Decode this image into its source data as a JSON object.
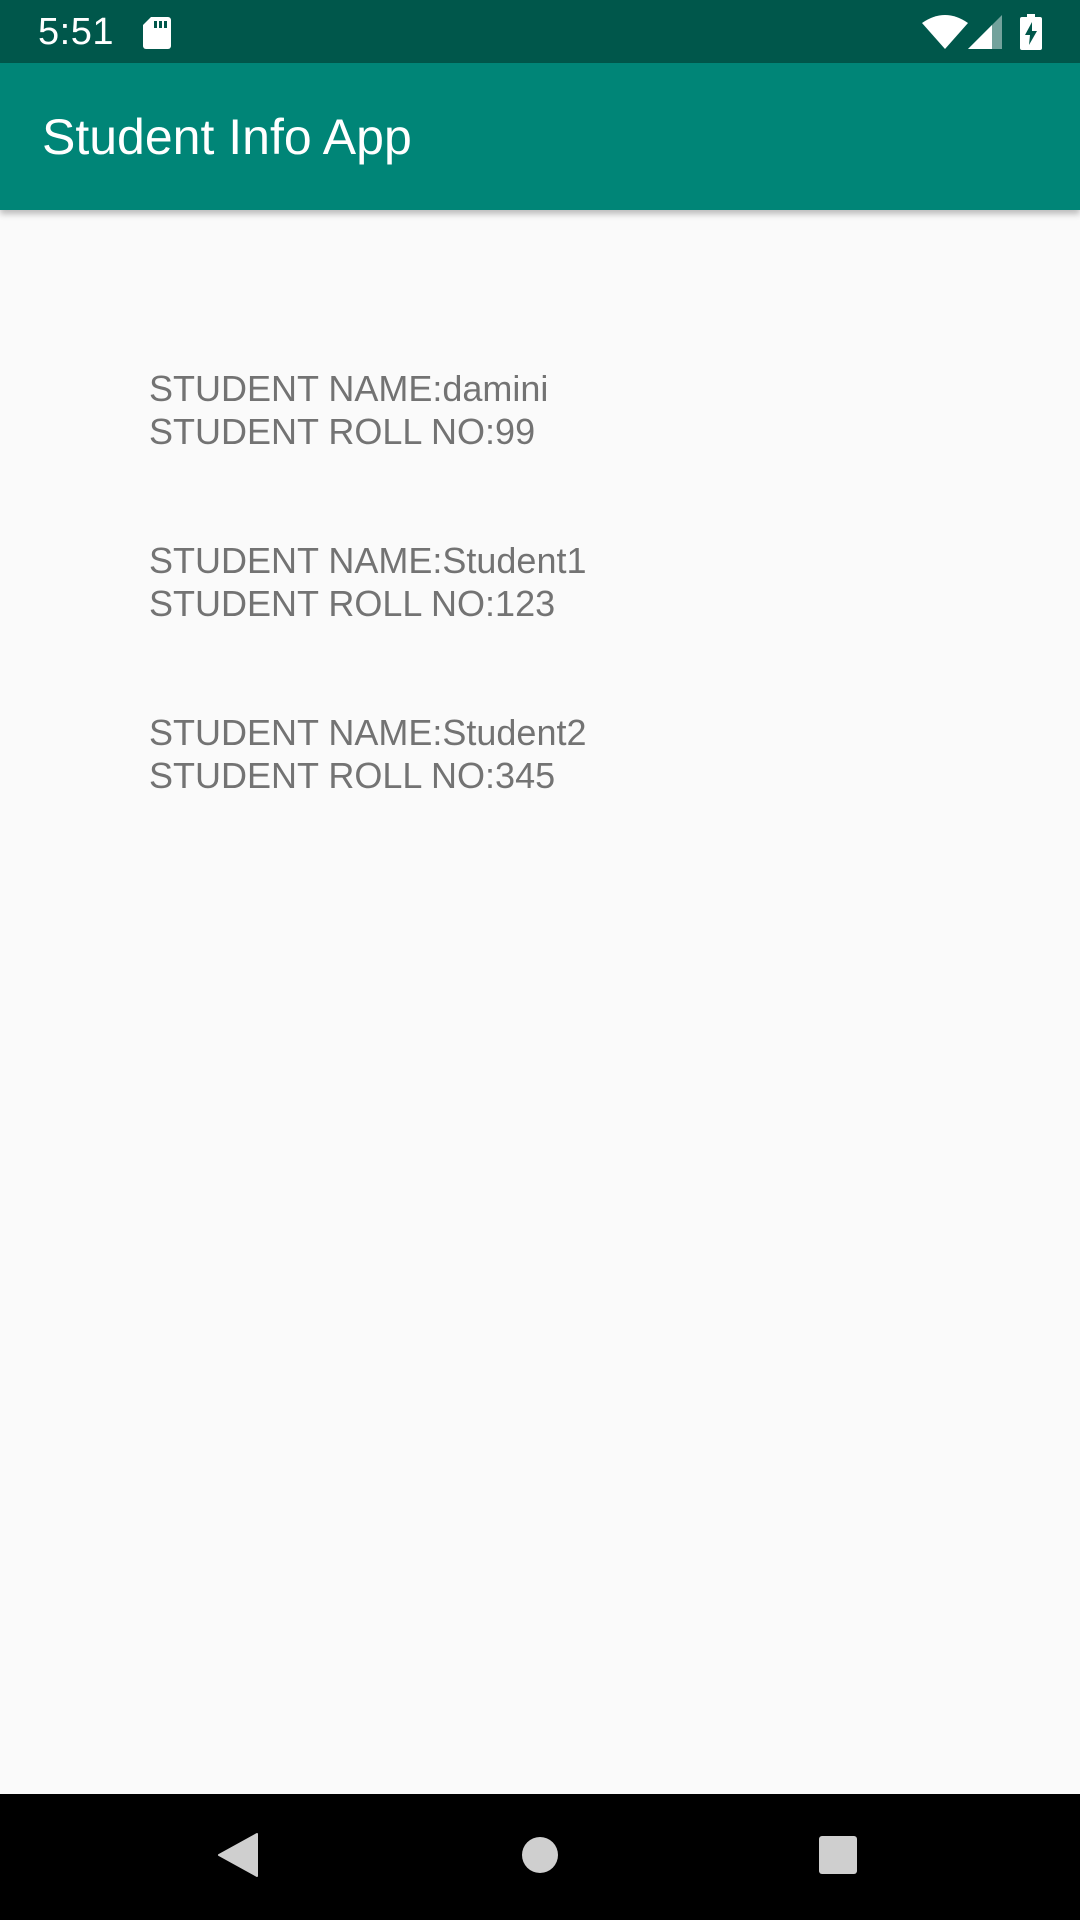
{
  "status_bar": {
    "time": "5:51",
    "icons": [
      "sd-card-icon",
      "wifi-icon",
      "cell-signal-icon",
      "battery-charging-icon"
    ]
  },
  "app_bar": {
    "title": "Student Info App"
  },
  "students": [
    {
      "name_line": "STUDENT NAME:damini",
      "roll_line": "STUDENT ROLL NO:99"
    },
    {
      "name_line": "STUDENT NAME:Student1",
      "roll_line": "STUDENT ROLL NO:123"
    },
    {
      "name_line": "STUDENT NAME:Student2",
      "roll_line": "STUDENT ROLL NO:345"
    }
  ],
  "nav_bar": {
    "buttons": [
      "back-icon",
      "home-icon",
      "recents-icon"
    ]
  },
  "colors": {
    "status_bar": "#00574b",
    "app_bar": "#008577",
    "background": "#fafafa",
    "text": "#737373",
    "nav_bar": "#000000"
  }
}
